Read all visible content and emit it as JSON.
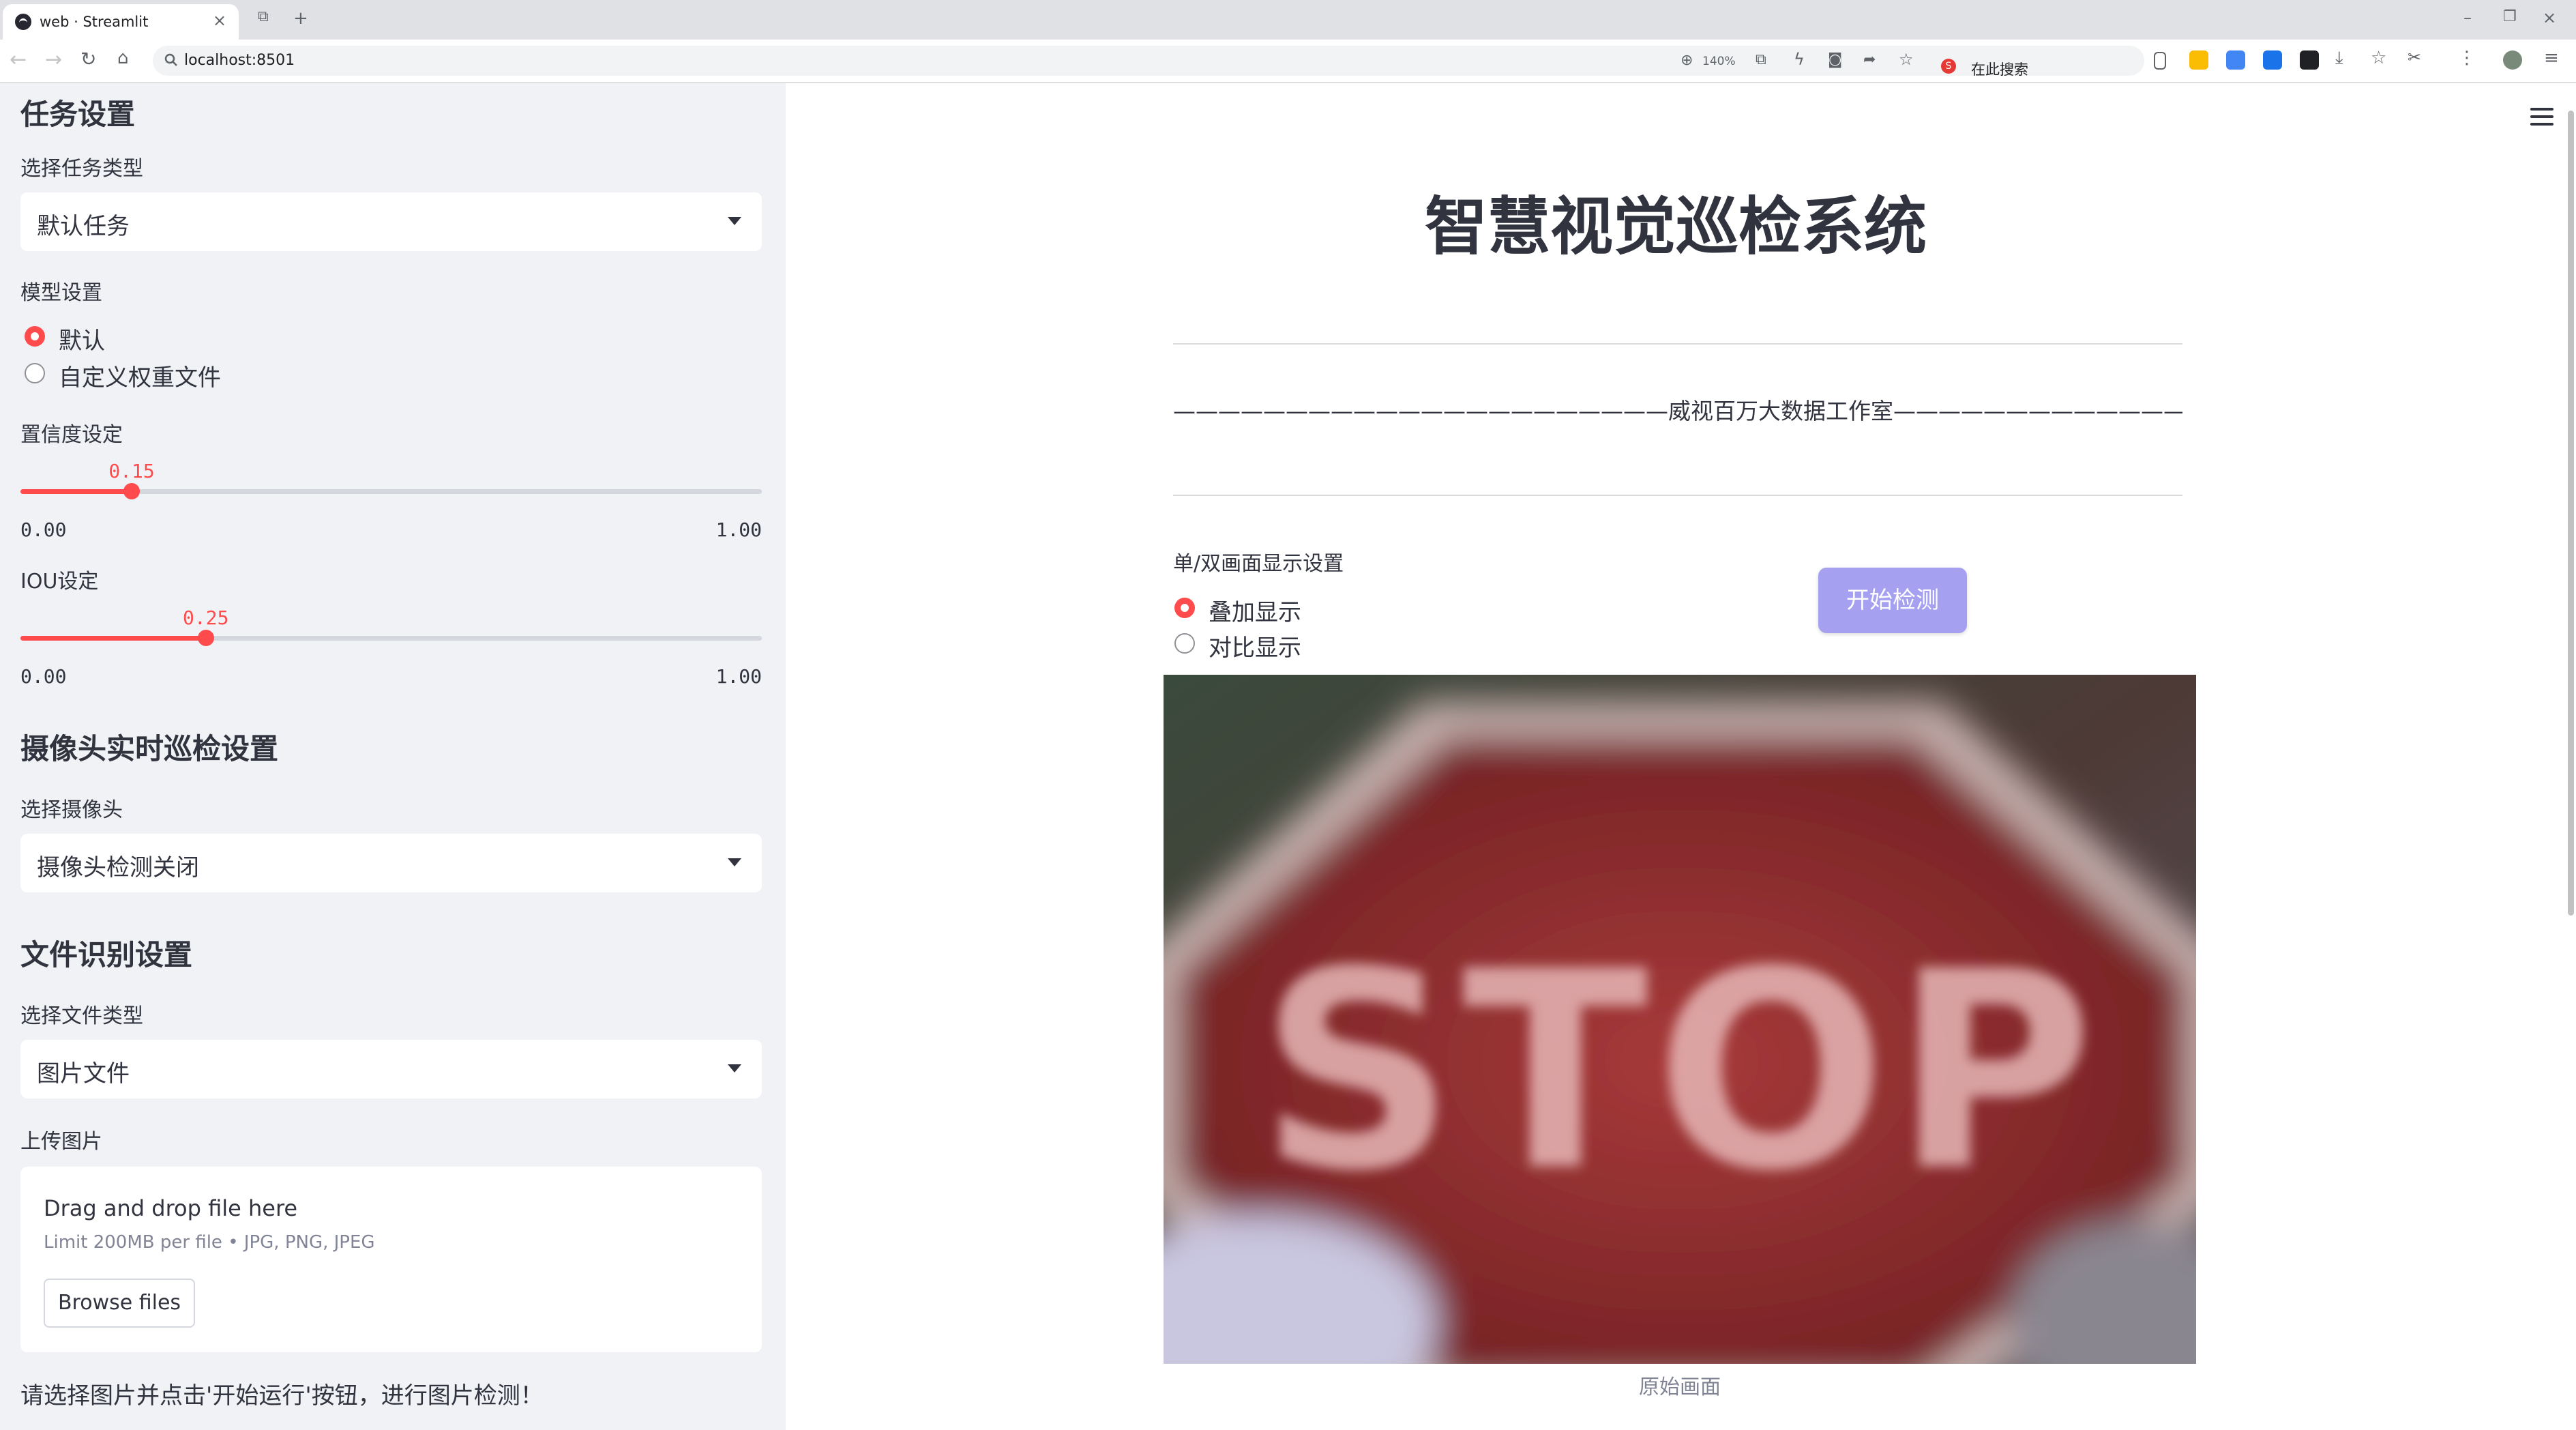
{
  "browser": {
    "tab_title": "web · Streamlit",
    "url": "localhost:8501",
    "zoom": "140%",
    "search_placeholder": "在此搜索"
  },
  "sidebar": {
    "task_section_title": "任务设置",
    "task_type_label": "选择任务类型",
    "task_type_value": "默认任务",
    "model_label": "模型设置",
    "model_options": [
      "默认",
      "自定义权重文件"
    ],
    "model_selected": "默认",
    "confidence_label": "置信度设定",
    "confidence": {
      "value": 0.15,
      "display": "0.15",
      "min": "0.00",
      "max": "1.00"
    },
    "iou_label": "IOU设定",
    "iou": {
      "value": 0.25,
      "display": "0.25",
      "min": "0.00",
      "max": "1.00"
    },
    "camera_section_title": "摄像头实时巡检设置",
    "camera_label": "选择摄像头",
    "camera_value": "摄像头检测关闭",
    "file_section_title": "文件识别设置",
    "file_type_label": "选择文件类型",
    "file_type_value": "图片文件",
    "upload_label": "上传图片",
    "upload_title": "Drag and drop file here",
    "upload_limit": "Limit 200MB per file • JPG, PNG, JPEG",
    "browse_button": "Browse files",
    "hint": "请选择图片并点击'开始运行'按钮，进行图片检测！"
  },
  "main": {
    "title": "智慧视觉巡检系统",
    "subtitle": "——————————————————————威视百万大数据工作室—————————————————————",
    "display_label": "单/双画面显示设置",
    "display_options": [
      "叠加显示",
      "对比显示"
    ],
    "display_selected": "叠加显示",
    "start_button": "开始检测",
    "image_text": "STOP",
    "image_caption": "原始画面"
  },
  "colors": {
    "accent": "#ff4b4b",
    "button": "#a5a0f0",
    "sidebar_bg": "#f0f2f6",
    "text": "#31333f"
  }
}
